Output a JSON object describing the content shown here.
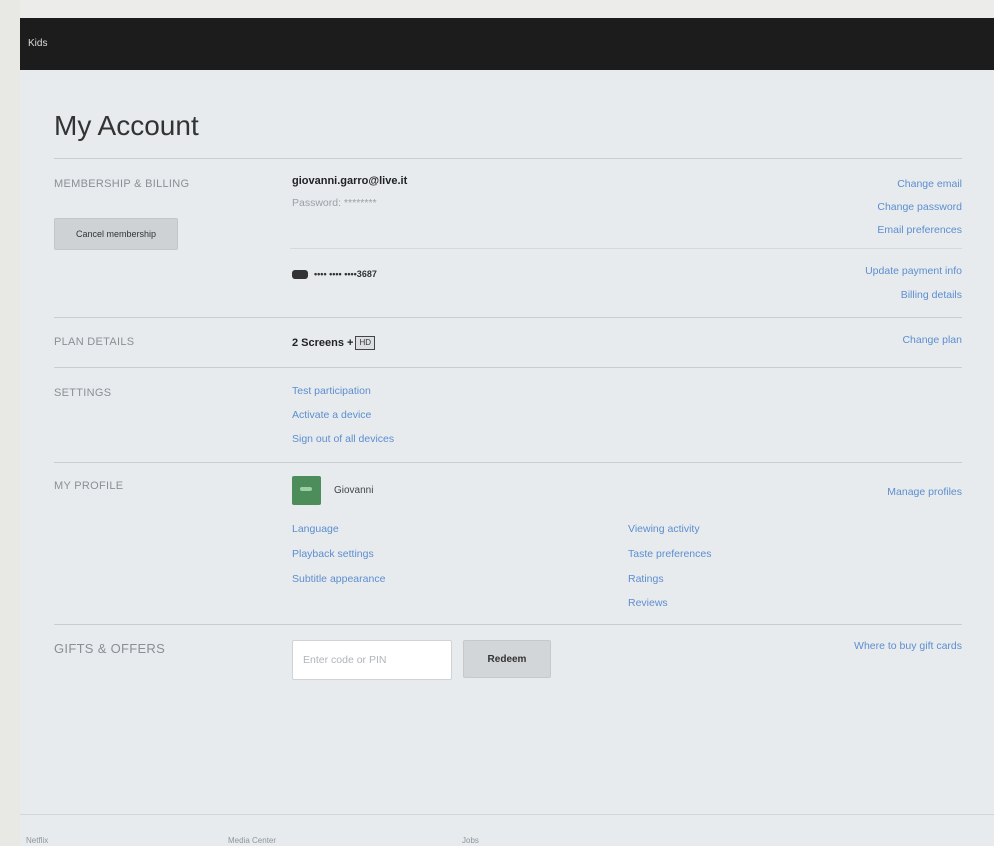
{
  "topbar": {
    "kids_label": "Kids"
  },
  "page_title": "My Account",
  "membership": {
    "section_label": "MEMBERSHIP & BILLING",
    "cancel_button": "Cancel membership",
    "email": "giovanni.garro@live.it",
    "password_label": "Password: ********",
    "links": [
      "Change email",
      "Change password",
      "Email preferences"
    ],
    "card_number": "•••• •••• ••••3687",
    "payment_links": [
      "Update payment info",
      "Billing details"
    ]
  },
  "plan": {
    "section_label": "PLAN DETAILS",
    "plan_text": "2 Screens +",
    "plan_badge": "HD",
    "change_link": "Change plan"
  },
  "settings": {
    "section_label": "SETTINGS",
    "links": [
      "Test participation",
      "Activate a device",
      "Sign out of all devices"
    ]
  },
  "profile": {
    "section_label": "MY PROFILE",
    "name": "Giovanni",
    "manage_link": "Manage profiles",
    "left_links": [
      "Language",
      "Playback settings",
      "Subtitle appearance"
    ],
    "right_links": [
      "Viewing activity",
      "Taste preferences",
      "Ratings",
      "Reviews"
    ]
  },
  "gifts": {
    "section_label": "GIFTS & OFFERS",
    "code_placeholder": "Enter code or PIN",
    "redeem_button": "Redeem",
    "buy_link": "Where to buy gift cards"
  },
  "footer": {
    "links": [
      "Netflix",
      "Media Center",
      "Jobs"
    ]
  },
  "colors": {
    "topbar": "#1c1c1c",
    "link": "#5d8ecf",
    "background": "#e7ebee"
  }
}
